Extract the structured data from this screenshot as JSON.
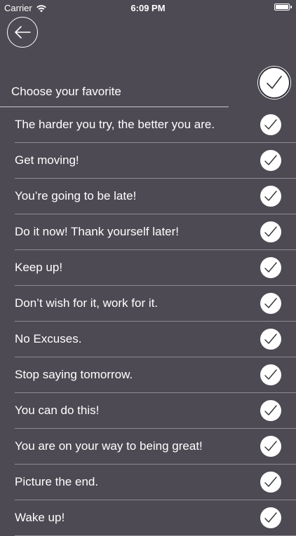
{
  "status_bar": {
    "carrier": "Carrier",
    "time": "6:09 PM",
    "battery_level": 1.0
  },
  "header": {
    "title": "Choose your favorite"
  },
  "icons": {
    "back": "back-arrow-icon",
    "select_all": "checkmark-icon",
    "item_check": "checkmark-icon"
  },
  "colors": {
    "background": "#4d4a53",
    "text": "#ffffff",
    "divider": "#8d8a93"
  },
  "items": [
    {
      "label": "The harder you try, the better you are.",
      "checked": true
    },
    {
      "label": "Get moving!",
      "checked": true
    },
    {
      "label": "You’re going to be late!",
      "checked": true
    },
    {
      "label": "Do it now! Thank yourself later!",
      "checked": true
    },
    {
      "label": "Keep up!",
      "checked": true
    },
    {
      "label": "Don’t wish for it, work for it.",
      "checked": true
    },
    {
      "label": "No Excuses.",
      "checked": true
    },
    {
      "label": "Stop saying tomorrow.",
      "checked": true
    },
    {
      "label": "You can do this!",
      "checked": true
    },
    {
      "label": "You are on your way to being great!",
      "checked": true
    },
    {
      "label": "Picture the end.",
      "checked": true
    },
    {
      "label": "Wake up!",
      "checked": true
    }
  ]
}
